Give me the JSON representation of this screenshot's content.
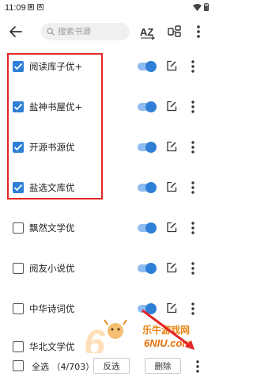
{
  "status_bar": {
    "time": "11:09"
  },
  "toolbar": {
    "search_placeholder": "搜索书源",
    "sort_label": "AZ"
  },
  "sources": [
    {
      "name": "阅读库子优+",
      "checked": true
    },
    {
      "name": "盐神书屋优+",
      "checked": true
    },
    {
      "name": "开源书源优",
      "checked": true
    },
    {
      "name": "盐选文库优",
      "checked": true
    },
    {
      "name": "飘然文学优",
      "checked": false
    },
    {
      "name": "阅友小说优",
      "checked": false
    },
    {
      "name": "中华诗词优",
      "checked": false
    },
    {
      "name": "华北文学优",
      "checked": false
    }
  ],
  "bottom_bar": {
    "select_all_label": "全选",
    "count": "（4/703）",
    "invert_label": "反选",
    "delete_label": "删除"
  },
  "watermark": {
    "cn": "乐牛游戏网",
    "en": "6NIU.com"
  },
  "colors": {
    "accent": "#2f7fd6",
    "toggle_track": "#8fbcf0",
    "annotation": "#e32626"
  }
}
